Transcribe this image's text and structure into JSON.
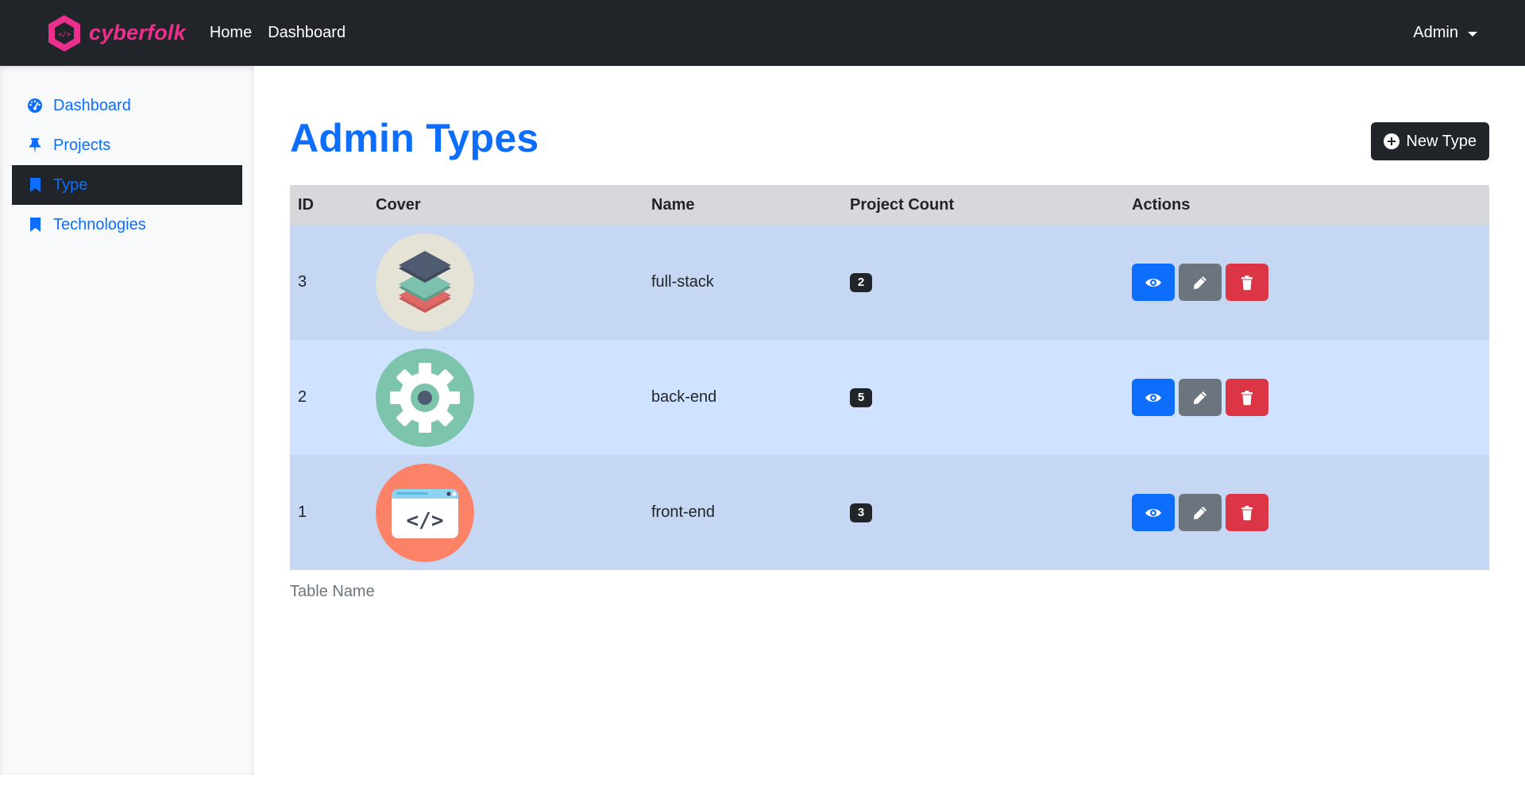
{
  "navbar": {
    "brand": "cyberfolk",
    "brand_color": "#ec2f8d",
    "links": [
      {
        "label": "Home"
      },
      {
        "label": "Dashboard"
      }
    ],
    "user_menu": "Admin"
  },
  "sidebar": {
    "items": [
      {
        "label": "Dashboard",
        "icon": "gauge-icon",
        "active": false
      },
      {
        "label": "Projects",
        "icon": "pin-icon",
        "active": false
      },
      {
        "label": "Type",
        "icon": "bookmark-icon",
        "active": true
      },
      {
        "label": "Technologies",
        "icon": "bookmark-icon",
        "active": false
      }
    ]
  },
  "main": {
    "title": "Admin Types",
    "new_button": "New Type",
    "table": {
      "headers": [
        "ID",
        "Cover",
        "Name",
        "Project Count",
        "Actions"
      ],
      "rows": [
        {
          "id": "3",
          "cover": "layers-icon",
          "name": "full-stack",
          "count": "2"
        },
        {
          "id": "2",
          "cover": "gear-icon",
          "name": "back-end",
          "count": "5"
        },
        {
          "id": "1",
          "cover": "code-window-icon",
          "name": "front-end",
          "count": "3"
        }
      ],
      "caption": "Table Name"
    }
  },
  "colors": {
    "primary": "#0d6efd",
    "dark": "#212529",
    "secondary": "#6c757d",
    "danger": "#dc3545",
    "row_odd": "#c5d7f2",
    "row_even": "#cfe2ff",
    "header_bg": "#d6d8db"
  }
}
